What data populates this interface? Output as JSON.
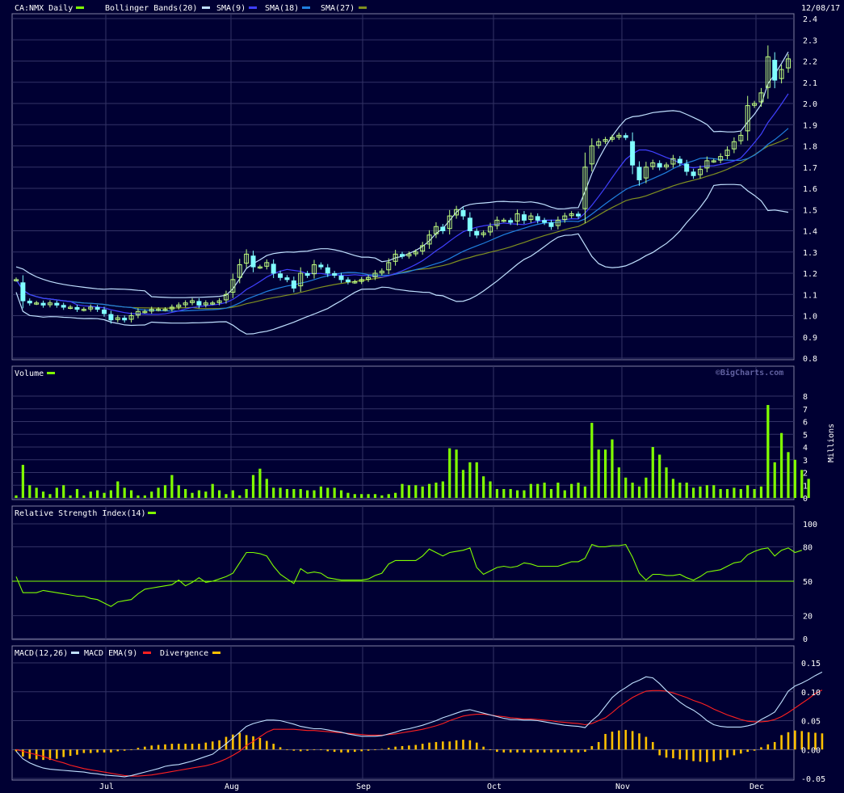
{
  "colors": {
    "background": "#000033",
    "panel_border": "#8080a0",
    "grid": "#333366",
    "up_candle": "#c0ff80",
    "down_candle": "#80ffff",
    "bollinger": "#c0e0ff",
    "sma9": "#4040ff",
    "sma18": "#2080e0",
    "sma27": "#809020",
    "volume": "#80ff00",
    "rsi": "#80ff00",
    "macd": "#c0e0ff",
    "macd_ema": "#ff2020",
    "divergence": "#ffc000",
    "legend_green": "#80ff00"
  },
  "header": {
    "symbol_label": "CA:NMX Daily",
    "bollinger_label": "Bollinger Bands(20)",
    "sma9_label": "SMA(9)",
    "sma18_label": "SMA(18)",
    "sma27_label": "SMA(27)",
    "date_label": "12/08/17"
  },
  "volume_panel": {
    "label": "Volume",
    "watermark": "©BigCharts.com",
    "unit_label": "Millions"
  },
  "rsi_panel": {
    "label": "Relative Strength Index(14)"
  },
  "macd_panel": {
    "label_macd": "MACD(12,26)",
    "label_ema": "MACD EMA(9)",
    "label_div": "Divergence"
  },
  "chart_data": [
    {
      "type": "candlestick",
      "title": "CA:NMX Daily",
      "ylim": [
        0.8,
        2.4
      ],
      "y_ticks": [
        "0.8",
        "0.9",
        "1.0",
        "1.1",
        "1.2",
        "1.3",
        "1.4",
        "1.5",
        "1.6",
        "1.7",
        "1.8",
        "1.9",
        "2.0",
        "2.1",
        "2.2",
        "2.3",
        "2.4"
      ],
      "x_tick_labels": [
        "Jul",
        "Aug",
        "Sep",
        "Oct",
        "Nov",
        "Dec"
      ],
      "close": [
        1.17,
        1.07,
        1.06,
        1.06,
        1.05,
        1.06,
        1.05,
        1.04,
        1.04,
        1.03,
        1.03,
        1.04,
        1.03,
        1.01,
        0.98,
        0.99,
        0.98,
        1.0,
        1.02,
        1.02,
        1.03,
        1.03,
        1.03,
        1.04,
        1.05,
        1.06,
        1.07,
        1.05,
        1.06,
        1.06,
        1.07,
        1.1,
        1.17,
        1.24,
        1.29,
        1.23,
        1.23,
        1.25,
        1.2,
        1.18,
        1.17,
        1.13,
        1.2,
        1.19,
        1.24,
        1.23,
        1.2,
        1.19,
        1.17,
        1.16,
        1.16,
        1.17,
        1.18,
        1.2,
        1.21,
        1.25,
        1.29,
        1.28,
        1.29,
        1.3,
        1.33,
        1.38,
        1.42,
        1.4,
        1.47,
        1.5,
        1.47,
        1.4,
        1.38,
        1.39,
        1.42,
        1.45,
        1.45,
        1.44,
        1.48,
        1.45,
        1.47,
        1.45,
        1.44,
        1.42,
        1.45,
        1.47,
        1.48,
        1.47,
        1.7,
        1.8,
        1.82,
        1.83,
        1.84,
        1.85,
        1.84,
        1.71,
        1.64,
        1.7,
        1.72,
        1.7,
        1.71,
        1.74,
        1.72,
        1.68,
        1.66,
        1.69,
        1.73,
        1.73,
        1.75,
        1.78,
        1.82,
        1.85,
        1.99,
        2.0,
        2.05,
        2.22,
        2.11,
        2.16,
        2.21
      ],
      "volume_unit": "Millions",
      "volume_ylim": [
        0,
        8
      ],
      "volume": [
        0.2,
        2.6,
        1.0,
        0.8,
        0.5,
        0.3,
        0.8,
        1.0,
        0.2,
        0.7,
        0.2,
        0.5,
        0.6,
        0.4,
        0.6,
        1.3,
        0.8,
        0.6,
        0.2,
        0.2,
        0.5,
        0.8,
        1.0,
        1.8,
        1.0,
        0.7,
        0.4,
        0.6,
        0.5,
        1.1,
        0.6,
        0.3,
        0.6,
        0.2,
        0.7,
        1.8,
        2.3,
        1.5,
        0.8,
        0.8,
        0.7,
        0.7,
        0.7,
        0.6,
        0.6,
        0.9,
        0.8,
        0.8,
        0.6,
        0.4,
        0.3,
        0.3,
        0.3,
        0.3,
        0.2,
        0.3,
        0.4,
        1.1,
        1.0,
        1.0,
        0.9,
        1.1,
        1.2,
        1.3,
        3.9,
        3.8,
        2.2,
        2.8,
        2.8,
        1.7,
        1.3,
        0.7,
        0.7,
        0.7,
        0.6,
        0.6,
        1.1,
        1.1,
        1.2,
        0.7,
        1.2,
        0.6,
        1.1,
        1.2,
        0.9,
        5.9,
        3.8,
        3.8,
        4.6,
        2.4,
        1.6,
        1.2,
        0.9,
        1.6,
        4.0,
        3.4,
        2.4,
        1.5,
        1.2,
        1.2,
        0.8,
        0.9,
        1.0,
        1.0,
        0.7,
        0.7,
        0.8,
        0.7,
        1.0,
        0.7,
        0.9,
        7.3,
        2.8,
        5.1,
        3.6,
        3.0,
        2.2,
        1.5
      ]
    },
    {
      "type": "line",
      "title": "Relative Strength Index(14)",
      "ylim": [
        0,
        100
      ],
      "y_ticks": [
        "0",
        "20",
        "50",
        "80",
        "100"
      ],
      "reference_line": 50,
      "values": [
        54,
        40,
        40,
        40,
        42,
        41,
        40,
        39,
        38,
        37,
        37,
        35,
        34,
        31,
        28,
        32,
        33,
        34,
        39,
        43,
        44,
        45,
        46,
        47,
        51,
        46,
        49,
        53,
        49,
        50,
        52,
        54,
        57,
        66,
        75,
        75,
        74,
        72,
        63,
        56,
        52,
        48,
        61,
        57,
        58,
        57,
        53,
        52,
        51,
        51,
        51,
        51,
        52,
        55,
        57,
        65,
        68,
        68,
        68,
        68,
        72,
        78,
        75,
        72,
        75,
        76,
        77,
        79,
        62,
        56,
        59,
        62,
        63,
        62,
        63,
        66,
        65,
        63,
        63,
        63,
        63,
        65,
        67,
        67,
        70,
        82,
        80,
        80,
        81,
        81,
        82,
        71,
        57,
        51,
        56,
        56,
        55,
        55,
        56,
        53,
        51,
        54,
        58,
        59,
        60,
        63,
        66,
        67,
        73,
        76,
        78,
        79,
        72,
        77,
        79,
        75,
        77
      ]
    },
    {
      "type": "line",
      "title": "MACD(12,26)",
      "ylim": [
        -0.05,
        0.15
      ],
      "y_ticks": [
        "-0.05",
        "0.00",
        "0.05",
        "0.10",
        "0.15"
      ],
      "macd": [
        -0.003,
        -0.016,
        -0.023,
        -0.028,
        -0.032,
        -0.034,
        -0.035,
        -0.036,
        -0.037,
        -0.038,
        -0.039,
        -0.041,
        -0.042,
        -0.044,
        -0.045,
        -0.046,
        -0.047,
        -0.045,
        -0.042,
        -0.039,
        -0.036,
        -0.033,
        -0.029,
        -0.027,
        -0.026,
        -0.023,
        -0.02,
        -0.016,
        -0.012,
        -0.008,
        0.001,
        0.01,
        0.02,
        0.03,
        0.04,
        0.045,
        0.048,
        0.051,
        0.051,
        0.05,
        0.047,
        0.044,
        0.04,
        0.038,
        0.036,
        0.036,
        0.034,
        0.032,
        0.03,
        0.027,
        0.025,
        0.023,
        0.023,
        0.023,
        0.024,
        0.027,
        0.03,
        0.034,
        0.036,
        0.039,
        0.042,
        0.046,
        0.05,
        0.055,
        0.059,
        0.063,
        0.067,
        0.069,
        0.066,
        0.063,
        0.06,
        0.057,
        0.054,
        0.052,
        0.052,
        0.051,
        0.051,
        0.05,
        0.048,
        0.046,
        0.044,
        0.042,
        0.041,
        0.04,
        0.038,
        0.05,
        0.06,
        0.075,
        0.09,
        0.1,
        0.107,
        0.115,
        0.12,
        0.126,
        0.124,
        0.114,
        0.102,
        0.092,
        0.082,
        0.074,
        0.068,
        0.06,
        0.05,
        0.043,
        0.04,
        0.039,
        0.039,
        0.039,
        0.041,
        0.044,
        0.052,
        0.058,
        0.065,
        0.082,
        0.101,
        0.11,
        0.115,
        0.121,
        0.128,
        0.134
      ],
      "macd_ema": [
        0.0,
        -0.003,
        -0.006,
        -0.009,
        -0.012,
        -0.016,
        -0.02,
        -0.023,
        -0.027,
        -0.03,
        -0.033,
        -0.035,
        -0.037,
        -0.039,
        -0.041,
        -0.043,
        -0.045,
        -0.046,
        -0.046,
        -0.045,
        -0.044,
        -0.042,
        -0.04,
        -0.038,
        -0.036,
        -0.034,
        -0.032,
        -0.03,
        -0.028,
        -0.025,
        -0.021,
        -0.016,
        -0.01,
        -0.003,
        0.007,
        0.014,
        0.022,
        0.03,
        0.035,
        0.035,
        0.035,
        0.035,
        0.034,
        0.033,
        0.033,
        0.032,
        0.031,
        0.03,
        0.029,
        0.028,
        0.027,
        0.026,
        0.025,
        0.025,
        0.025,
        0.026,
        0.027,
        0.029,
        0.031,
        0.033,
        0.035,
        0.038,
        0.041,
        0.045,
        0.05,
        0.054,
        0.058,
        0.06,
        0.061,
        0.061,
        0.06,
        0.058,
        0.057,
        0.055,
        0.054,
        0.053,
        0.053,
        0.052,
        0.051,
        0.05,
        0.048,
        0.047,
        0.046,
        0.045,
        0.043,
        0.045,
        0.05,
        0.055,
        0.064,
        0.074,
        0.082,
        0.09,
        0.096,
        0.101,
        0.102,
        0.102,
        0.101,
        0.098,
        0.094,
        0.09,
        0.085,
        0.081,
        0.076,
        0.07,
        0.065,
        0.06,
        0.056,
        0.052,
        0.049,
        0.048,
        0.048,
        0.049,
        0.052,
        0.057,
        0.064,
        0.072,
        0.08,
        0.088,
        0.097,
        0.103
      ],
      "divergence": [
        -0.003,
        -0.012,
        -0.016,
        -0.017,
        -0.018,
        -0.018,
        -0.016,
        -0.013,
        -0.011,
        -0.009,
        -0.006,
        -0.006,
        -0.005,
        -0.005,
        -0.005,
        -0.003,
        -0.002,
        -0.001,
        0.003,
        0.005,
        0.007,
        0.008,
        0.009,
        0.01,
        0.01,
        0.01,
        0.01,
        0.01,
        0.012,
        0.014,
        0.016,
        0.022,
        0.026,
        0.029,
        0.025,
        0.023,
        0.02,
        0.015,
        0.01,
        0.004,
        -0.001,
        -0.002,
        -0.003,
        -0.002,
        -0.001,
        -0.001,
        -0.003,
        -0.004,
        -0.005,
        -0.005,
        -0.004,
        -0.003,
        -0.002,
        -0.001,
        0.001,
        0.003,
        0.005,
        0.006,
        0.007,
        0.008,
        0.01,
        0.012,
        0.013,
        0.014,
        0.014,
        0.016,
        0.017,
        0.016,
        0.012,
        0.005,
        -0.001,
        -0.004,
        -0.005,
        -0.005,
        -0.005,
        -0.005,
        -0.005,
        -0.005,
        -0.005,
        -0.005,
        -0.005,
        -0.005,
        -0.005,
        -0.005,
        -0.004,
        0.006,
        0.013,
        0.027,
        0.031,
        0.033,
        0.034,
        0.032,
        0.028,
        0.022,
        0.013,
        -0.01,
        -0.014,
        -0.015,
        -0.017,
        -0.018,
        -0.02,
        -0.021,
        -0.022,
        -0.02,
        -0.018,
        -0.014,
        -0.01,
        -0.007,
        -0.004,
        -0.002,
        0.004,
        0.009,
        0.013,
        0.025,
        0.03,
        0.033,
        0.032,
        0.03,
        0.029,
        0.028
      ]
    }
  ]
}
